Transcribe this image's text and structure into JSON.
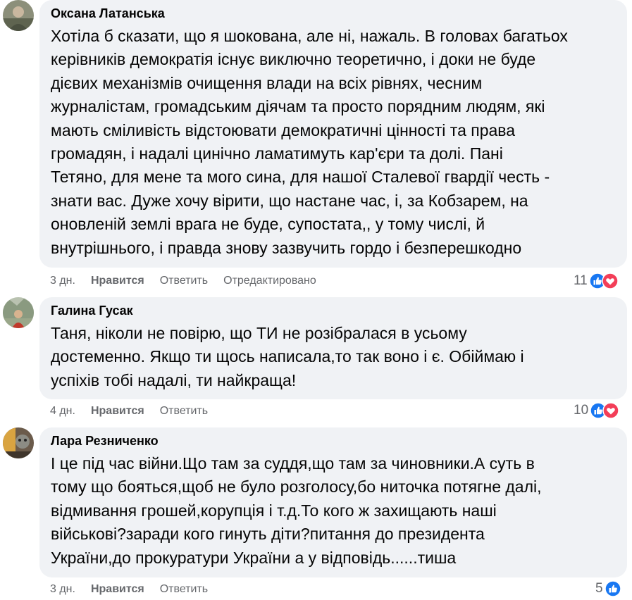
{
  "comments": [
    {
      "author": "Оксана Латанська",
      "lines": [
        "Хотіла б сказати, що я шокована, але ні, нажаль. В головах багатьох",
        "керівників демократія існує виключно теоретично, і доки не буде",
        "дієвих механізмів очищення влади на всіх рівнях, чесним",
        "журналістам, громадським діячам та просто порядним людям, які",
        "мають сміливість відстоювати демократичні цінності та права",
        "громадян, і надалі цинічно ламатимуть кар'єри та долі. Пані",
        "Тетяно, для мене та мого сина, для нашої Сталевої гвардії честь -",
        "знати вас. Дуже хочу вірити, що настане час, і, за Кобзарем, на",
        "оновленій землі врага не буде, супостата,, у тому числі, й",
        "внутрішнього, і правда знову зазвучить гордо і безперешкодно"
      ],
      "time": "3 дн.",
      "like_label": "Нравится",
      "reply_label": "Ответить",
      "edited_label": "Отредактировано",
      "reaction_count": "11",
      "reactions": [
        "like-icon",
        "love-icon"
      ]
    },
    {
      "author": "Галина Гусак",
      "lines": [
        "Таня, ніколи не повірю, що ТИ не розібралася в усьому",
        "достеменно. Якщо ти щось написала,то так воно і є. Обіймаю і",
        "успіхів тобі надалі, ти найкраща!"
      ],
      "time": "4 дн.",
      "like_label": "Нравится",
      "reply_label": "Ответить",
      "reaction_count": "10",
      "reactions": [
        "like-icon",
        "love-icon"
      ]
    },
    {
      "author": "Лара Резниченко",
      "lines": [
        "І це під час війни.Що там за суддя,що там за чиновники.А суть в",
        "тому що бояться,щоб не було розголосу,бо ниточка потягне далі,",
        "відмивання грошей,корупція і т.д.То кого ж захищають наші",
        "військові?заради кого гинуть діти?питання до президента",
        "України,до прокуратури України а у відповідь......тиша"
      ],
      "time": "3 дн.",
      "like_label": "Нравится",
      "reply_label": "Ответить",
      "reaction_count": "5",
      "reactions": [
        "like-icon"
      ]
    }
  ],
  "colors": {
    "bubble": "#f0f2f5",
    "meta_text": "#65676b",
    "like_blue": "#1877f2",
    "love_red": "#f33e58"
  }
}
